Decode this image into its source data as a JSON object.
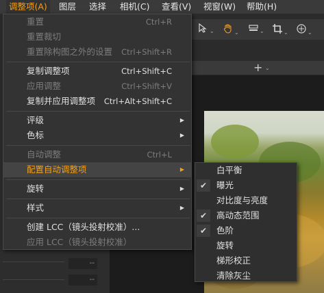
{
  "menubar": {
    "items": [
      "调整项(A)",
      "图层",
      "选择",
      "相机(C)",
      "查看(V)",
      "视窗(W)",
      "帮助(H)"
    ],
    "active_color": "#f0a020"
  },
  "toolbar": {
    "icons": [
      "cursor-select-icon",
      "hand-pan-icon",
      "level-tool-icon",
      "crop-icon",
      "rotate-icon"
    ]
  },
  "add_row": {
    "plus": "+"
  },
  "fields": [
    "--",
    "--"
  ],
  "menu": {
    "items": [
      {
        "label": "重置",
        "shortcut": "Ctrl+R",
        "enabled": false
      },
      {
        "label": "重置裁切",
        "shortcut": "",
        "enabled": false
      },
      {
        "label": "重置除构图之外的设置",
        "shortcut": "Ctrl+Shift+R",
        "enabled": false
      },
      {
        "label": "复制调整项",
        "shortcut": "Ctrl+Shift+C",
        "enabled": true
      },
      {
        "label": "应用调整",
        "shortcut": "Ctrl+Shift+V",
        "enabled": false
      },
      {
        "label": "复制并应用调整项",
        "shortcut": "Ctrl+Alt+Shift+C",
        "enabled": true
      },
      {
        "label": "评级",
        "shortcut": "",
        "enabled": true,
        "submenu": true
      },
      {
        "label": "色标",
        "shortcut": "",
        "enabled": true,
        "submenu": true
      },
      {
        "label": "自动调整",
        "shortcut": "Ctrl+L",
        "enabled": false
      },
      {
        "label": "配置自动调整项",
        "shortcut": "",
        "enabled": true,
        "submenu": true,
        "highlighted": true
      },
      {
        "label": "旋转",
        "shortcut": "",
        "enabled": true,
        "submenu": true
      },
      {
        "label": "样式",
        "shortcut": "",
        "enabled": true,
        "submenu": true
      },
      {
        "label": "创建 LCC（镜头投射校准）...",
        "shortcut": "",
        "enabled": true
      },
      {
        "label": "应用 LCC（镜头投射校准）",
        "shortcut": "",
        "enabled": false
      }
    ]
  },
  "submenu": {
    "items": [
      {
        "label": "白平衡",
        "checked": false
      },
      {
        "label": "曝光",
        "checked": true
      },
      {
        "label": "对比度与亮度",
        "checked": false
      },
      {
        "label": "高动态范围",
        "checked": true
      },
      {
        "label": "色阶",
        "checked": true
      },
      {
        "label": "旋转",
        "checked": false
      },
      {
        "label": "梯形校正",
        "checked": false
      },
      {
        "label": "清除灰尘",
        "checked": false
      }
    ],
    "check_glyph": "✔"
  },
  "submenu_arrow": "▶"
}
